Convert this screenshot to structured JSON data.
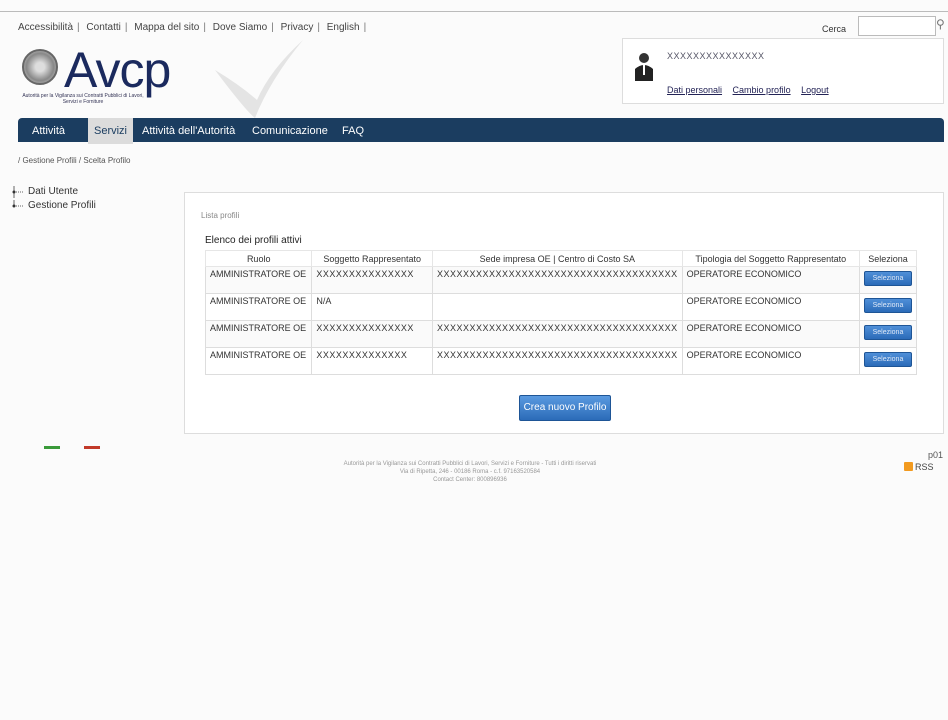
{
  "header": {
    "top_links": [
      "Accessibilità",
      "Contatti",
      "Mappa del sito",
      "Dove Siamo",
      "Privacy",
      "English"
    ],
    "search_label": "Cerca",
    "search_value": ""
  },
  "logo": {
    "text": "Avcp",
    "subtitle": "Autorità per la Vigilanza sui Contratti Pubblici di Lavori, Servizi e Forniture"
  },
  "user": {
    "name": "XXXXXXXXXXXXXXX",
    "links": [
      "Dati personali",
      "Cambio profilo",
      "Logout"
    ]
  },
  "nav": {
    "items": [
      "Attività",
      "Servizi",
      "Attività dell'Autorità",
      "Comunicazione",
      "FAQ"
    ],
    "active_index": 1
  },
  "breadcrumb": "/ Gestione Profili / Scelta Profilo",
  "sidebar": {
    "items": [
      "Dati Utente",
      "Gestione Profili"
    ]
  },
  "panel": {
    "legend": "Lista profili",
    "title": "Elenco dei profili attivi",
    "columns": [
      "Ruolo",
      "Soggetto Rappresentato",
      "Sede impresa OE | Centro di Costo SA",
      "Tipologia del Soggetto Rappresentato",
      "Seleziona"
    ],
    "rows": [
      {
        "ruolo": "AMMINISTRATORE OE",
        "soggetto": "XXXXXXXXXXXXXXX",
        "sede": "XXXXXXXXXXXXXXXXXXXXXXXXXXXXXXXXXXXXX",
        "tipologia": "OPERATORE ECONOMICO",
        "button": "Seleziona"
      },
      {
        "ruolo": "AMMINISTRATORE OE",
        "soggetto": "N/A",
        "sede": "",
        "tipologia": "OPERATORE ECONOMICO",
        "button": "Seleziona"
      },
      {
        "ruolo": "AMMINISTRATORE OE",
        "soggetto": "XXXXXXXXXXXXXXX",
        "sede": "XXXXXXXXXXXXXXXXXXXXXXXXXXXXXXXXXXXXX",
        "tipologia": "OPERATORE ECONOMICO",
        "button": "Seleziona"
      },
      {
        "ruolo": "AMMINISTRATORE OE",
        "soggetto": "XXXXXXXXXXXXXX",
        "sede": "XXXXXXXXXXXXXXXXXXXXXXXXXXXXXXXXXXXXX",
        "tipologia": "OPERATORE ECONOMICO",
        "button": "Seleziona"
      }
    ],
    "new_button": "Crea nuovo Profilo"
  },
  "footer": {
    "code": "p01",
    "rss": "RSS",
    "lines": [
      "Autorità per la Vigilanza sui Contratti Pubblici di Lavori, Servizi e Forniture - Tutti i diritti riservati",
      "Via di Ripetta, 246 - 00186 Roma - c.f. 97163520584",
      "Contact Center: 800896936"
    ]
  },
  "colors": {
    "nav_bg": "#1b3d60",
    "button_blue": "#2b6bb8",
    "logo_blue": "#1b2a5e"
  }
}
